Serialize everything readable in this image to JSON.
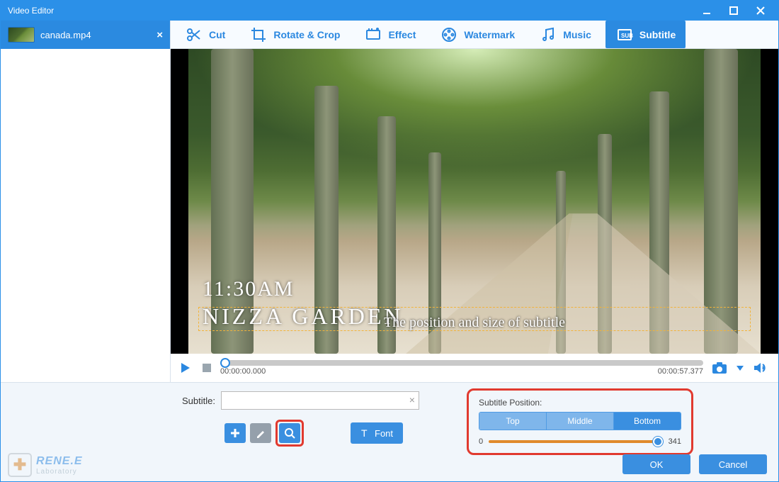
{
  "window": {
    "title": "Video Editor"
  },
  "sidebar": {
    "file": {
      "name": "canada.mp4"
    }
  },
  "tabs": {
    "cut": "Cut",
    "rotate": "Rotate & Crop",
    "effect": "Effect",
    "watermark": "Watermark",
    "music": "Music",
    "subtitle": "Subtitle",
    "active": "subtitle"
  },
  "preview": {
    "overlay_clock": "11:30AM",
    "overlay_place": "NIZZA GARDEN",
    "subtitle_sample": "The position and size of subtitle"
  },
  "playbar": {
    "time_start": "00:00:00.000",
    "time_end": "00:00:57.377"
  },
  "subtitle_panel": {
    "label": "Subtitle:",
    "input_value": "",
    "font_button": "Font"
  },
  "position_panel": {
    "title": "Subtitle Position:",
    "options": {
      "top": "Top",
      "middle": "Middle",
      "bottom": "Bottom"
    },
    "selected": "bottom",
    "slider_min": "0",
    "slider_value": "341"
  },
  "dialog": {
    "ok": "OK",
    "cancel": "Cancel"
  },
  "brand": {
    "name": "RENE.E",
    "sub": "Laboratory"
  }
}
